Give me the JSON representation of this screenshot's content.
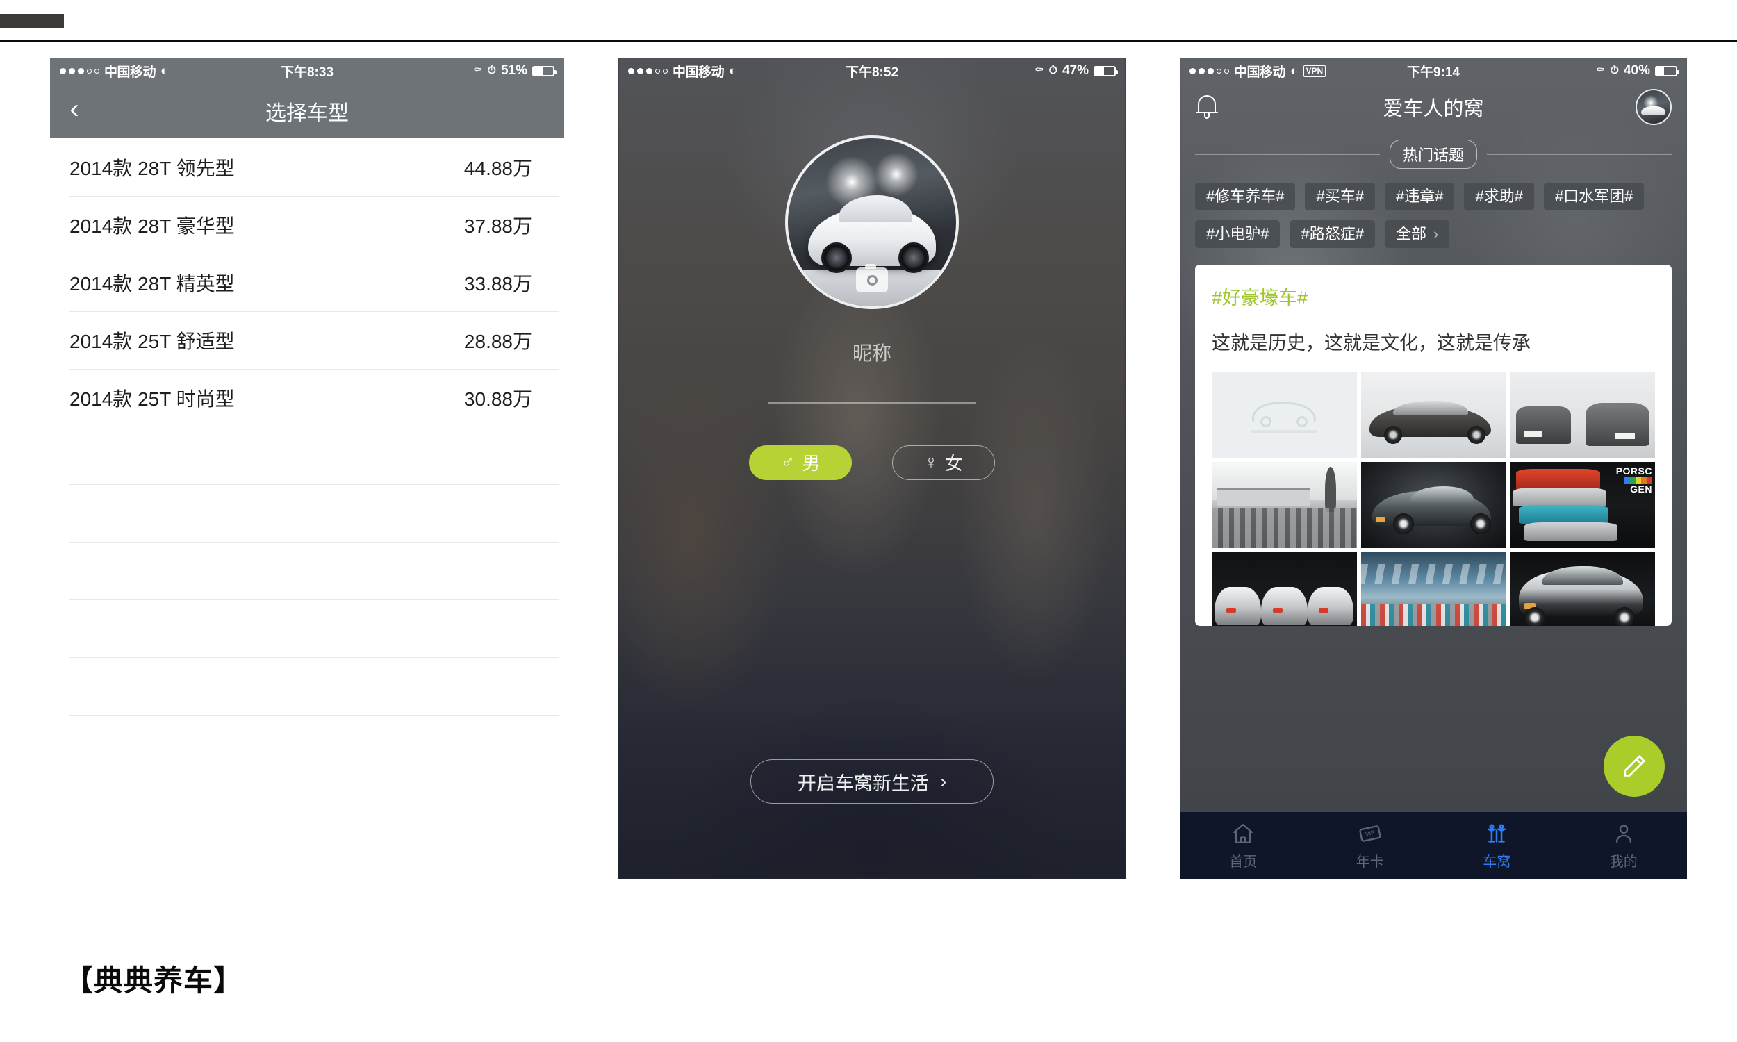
{
  "caption": "【典典养车】",
  "phone1": {
    "status": {
      "carrier": "中国移动",
      "signal_dots": "●●●○○",
      "wifi_icon": "wifi-icon",
      "time": "下午8:33",
      "lock_icon": "rotation-lock-icon",
      "alarm_icon": "alarm-icon",
      "battery_pct": "51%"
    },
    "nav": {
      "back_icon": "chevron-left-icon",
      "title": "选择车型"
    },
    "list": {
      "rows": [
        {
          "name": "2014款 28T 领先型",
          "price": "44.88万"
        },
        {
          "name": "2014款 28T 豪华型",
          "price": "37.88万"
        },
        {
          "name": "2014款 28T 精英型",
          "price": "33.88万"
        },
        {
          "name": "2014款 25T 舒适型",
          "price": "28.88万"
        },
        {
          "name": "2014款 25T 时尚型",
          "price": "30.88万"
        }
      ],
      "empty_row_count": 6
    }
  },
  "phone2": {
    "status": {
      "carrier": "中国移动",
      "time": "下午8:52",
      "battery_pct": "47%"
    },
    "avatar": {
      "name": "user-avatar",
      "camera_icon": "camera-icon"
    },
    "nickname_placeholder": "昵称",
    "gender": {
      "male": {
        "label": "男",
        "symbol": "♂",
        "selected": true
      },
      "female": {
        "label": "女",
        "symbol": "♀",
        "selected": false
      },
      "selected_color": "#b5d334"
    },
    "cta": {
      "label": "开启车窝新生活",
      "chevron": "›"
    }
  },
  "phone3": {
    "status": {
      "carrier": "中国移动",
      "vpn": "VPN",
      "time": "下午9:14",
      "battery_pct": "40%"
    },
    "nav": {
      "bell_icon": "bell-icon",
      "title": "爱车人的窝",
      "avatar_icon": "user-avatar"
    },
    "hot_topics_label": "热门话题",
    "tags": [
      "#修车养车#",
      "#买车#",
      "#违章#",
      "#求助#",
      "#口水军团#",
      "#小电驴#",
      "#路怒症#"
    ],
    "tags_more": {
      "label": "全部",
      "chevron": "›"
    },
    "card": {
      "topic": "#好豪壕车#",
      "topic_color": "#9ec62a",
      "text": "这就是历史，这就是文化，这就是传承",
      "images": [
        {
          "name": "image-placeholder",
          "kind": "placeholder"
        },
        {
          "name": "classic-porsche-911-side",
          "kind": "photo"
        },
        {
          "name": "porsche-911-rear-pair",
          "kind": "photo"
        },
        {
          "name": "vintage-porsche-lot",
          "kind": "photo"
        },
        {
          "name": "porsche-930-turbo-dark",
          "kind": "photo"
        },
        {
          "name": "porsche-generations-stack",
          "kind": "photo",
          "watermark_line1": "PORSC",
          "watermark_line2": "GEN"
        },
        {
          "name": "porsche-996-row-silver",
          "kind": "photo"
        },
        {
          "name": "porsche-lineup-beach-sky",
          "kind": "photo"
        },
        {
          "name": "porsche-993-turbo-rear",
          "kind": "photo"
        }
      ]
    },
    "fab": {
      "icon": "compose-pencil-icon",
      "color": "#aacd2a"
    },
    "tabs": [
      {
        "label": "首页",
        "icon": "home-icon",
        "active": false
      },
      {
        "label": "年卡",
        "icon": "vip-card-icon",
        "active": false
      },
      {
        "label": "车窝",
        "icon": "community-people-icon",
        "active": true
      },
      {
        "label": "我的",
        "icon": "person-icon",
        "active": false
      }
    ],
    "active_tab_color": "#2f7df6"
  }
}
